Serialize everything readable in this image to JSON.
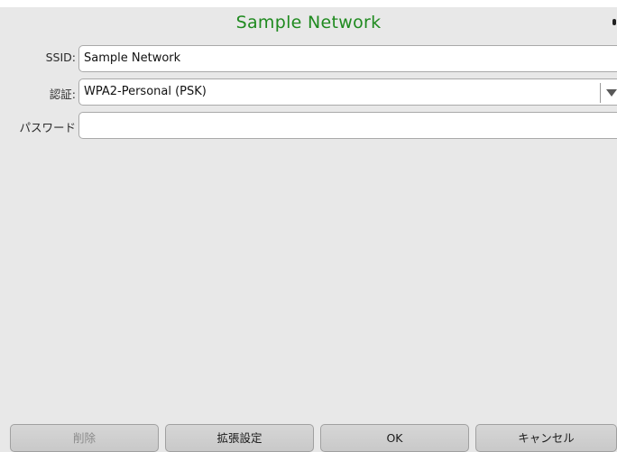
{
  "window": {
    "title": "Sample Network"
  },
  "form": {
    "ssid_label": "SSID:",
    "ssid_value": "Sample Network",
    "auth_label": "認証:",
    "auth_value": "WPA2-Personal (PSK)",
    "password_label": "パスワード",
    "password_value": ""
  },
  "buttons": {
    "delete": "削除",
    "advanced": "拡張設定",
    "ok": "OK",
    "cancel": "キャンセル"
  },
  "colors": {
    "title": "#1f8a1f",
    "background": "#e8e8e8",
    "button": "#cfcfcf",
    "disabled_text": "#8a8a8a"
  }
}
